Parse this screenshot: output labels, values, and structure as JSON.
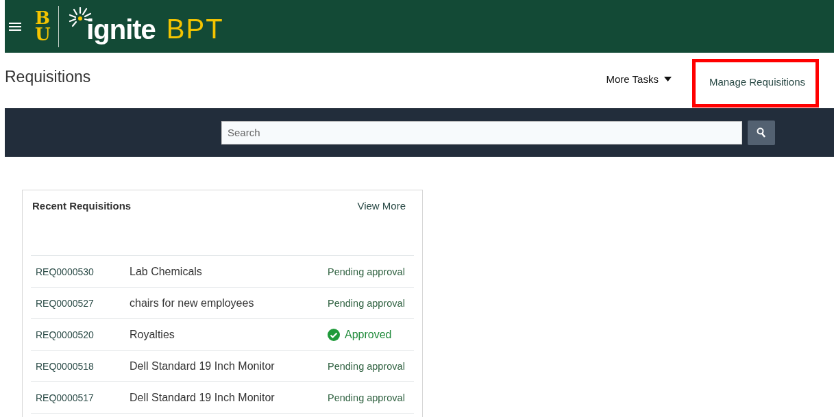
{
  "header": {
    "monogram": "BU",
    "brand": "ignite",
    "product": "BPT"
  },
  "page": {
    "title": "Requisitions",
    "more_tasks": "More Tasks",
    "manage_link": {
      "label": "Manage Requisitions",
      "highlighted": true
    }
  },
  "search": {
    "placeholder": "Search"
  },
  "recent": {
    "title": "Recent Requisitions",
    "view_more": "View More",
    "rows": [
      {
        "id": "REQ0000530",
        "description": "Lab Chemicals",
        "status": "Pending approval",
        "kind": "pending"
      },
      {
        "id": "REQ0000527",
        "description": "chairs for new employees",
        "status": "Pending approval",
        "kind": "pending"
      },
      {
        "id": "REQ0000520",
        "description": "Royalties",
        "status": "Approved",
        "kind": "approved"
      },
      {
        "id": "REQ0000518",
        "description": "Dell Standard 19 Inch Monitor",
        "status": "Pending approval",
        "kind": "pending"
      },
      {
        "id": "REQ0000517",
        "description": "Dell Standard 19 Inch Monitor",
        "status": "Pending approval",
        "kind": "pending"
      }
    ]
  }
}
